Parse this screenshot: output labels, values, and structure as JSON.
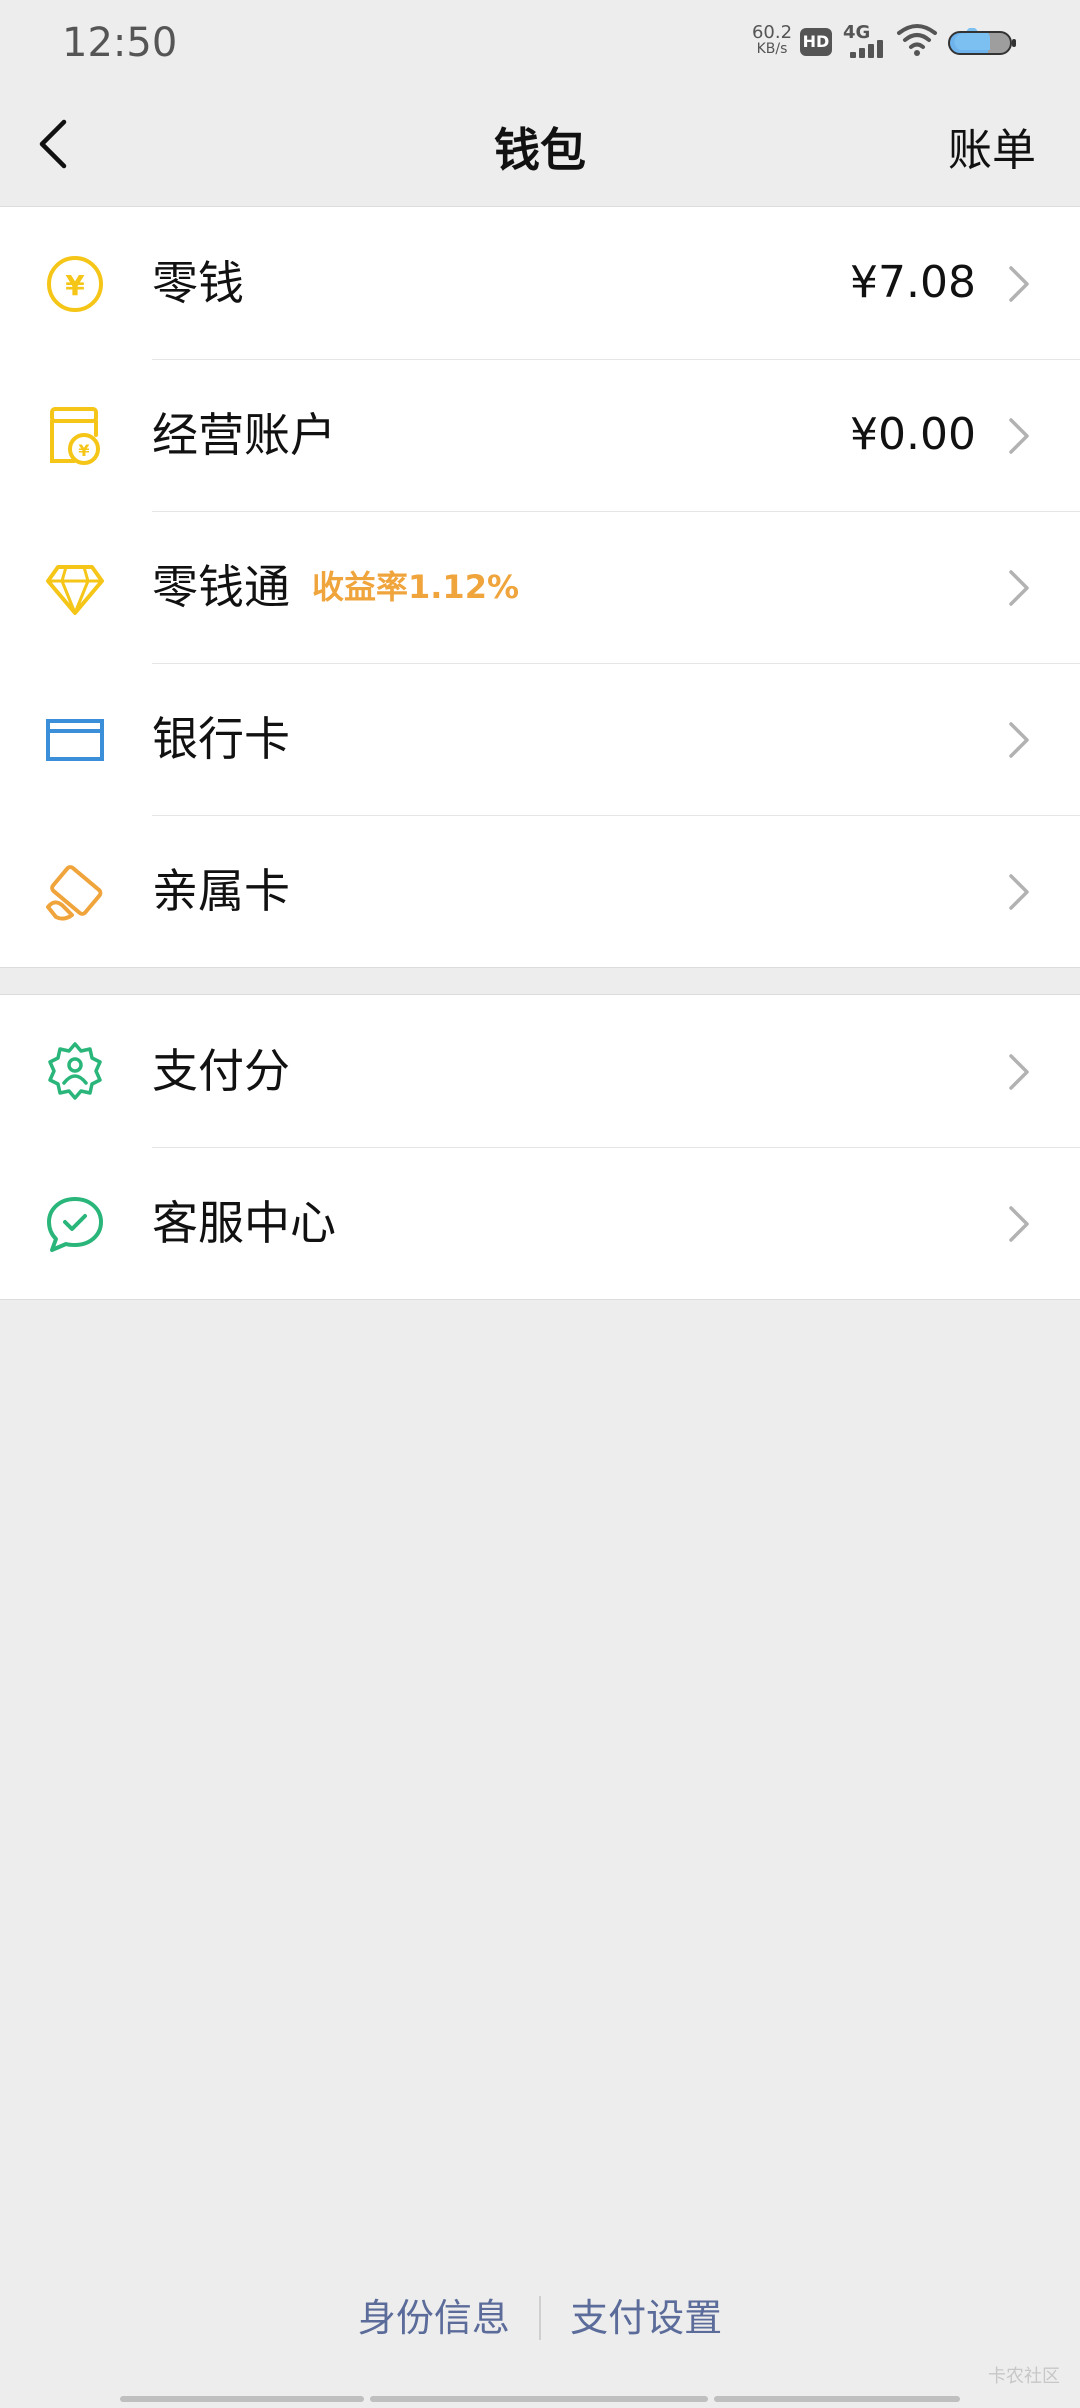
{
  "status_bar": {
    "time": "12:50",
    "net_speed_value": "60.2",
    "net_speed_unit": "KB/s",
    "hd_badge": "HD",
    "signal_label": "4G",
    "icons": [
      "hd-icon",
      "signal-4g-icon",
      "wifi-icon",
      "battery-icon"
    ]
  },
  "nav": {
    "back_icon": "chevron-left-icon",
    "title": "钱包",
    "bill_label": "账单"
  },
  "groups": [
    {
      "items": [
        {
          "icon": "yuan-coin-icon",
          "label": "零钱",
          "value": "¥7.08"
        },
        {
          "icon": "store-account-icon",
          "label": "经营账户",
          "value": "¥0.00"
        },
        {
          "icon": "diamond-icon",
          "label": "零钱通",
          "tag": "收益率1.12%"
        },
        {
          "icon": "bank-card-icon",
          "label": "银行卡"
        },
        {
          "icon": "family-card-icon",
          "label": "亲属卡"
        }
      ]
    },
    {
      "items": [
        {
          "icon": "pay-score-badge-icon",
          "label": "支付分"
        },
        {
          "icon": "customer-service-chat-icon",
          "label": "客服中心"
        }
      ]
    }
  ],
  "footer": {
    "identity_label": "身份信息",
    "pay_settings_label": "支付设置"
  },
  "watermark": "卡农社区",
  "colors": {
    "background": "#ededed",
    "yellow_icon": "#f5c518",
    "orange_accent": "#f0a43c",
    "blue_icon": "#3a8fd8",
    "green_icon": "#2ab67a",
    "footer_link": "#5b6b9a"
  }
}
